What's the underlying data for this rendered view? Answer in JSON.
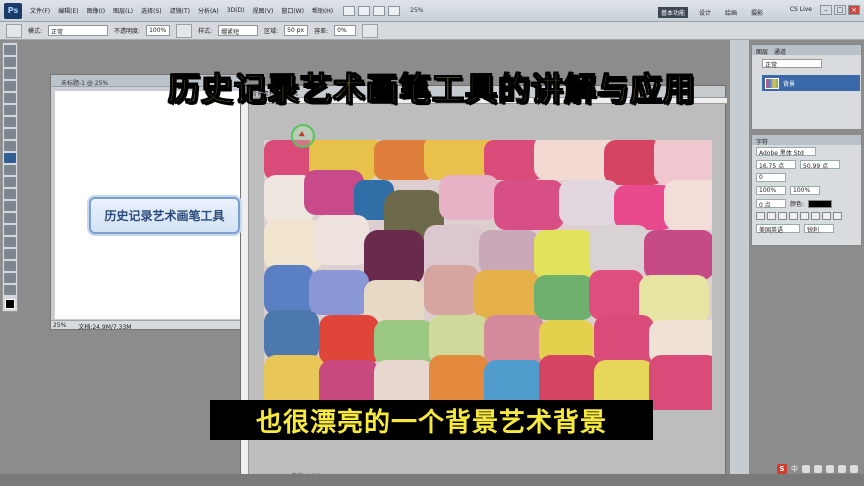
{
  "app": {
    "logo": "Ps",
    "menus": [
      "文件(F)",
      "编辑(E)",
      "图像(I)",
      "图层(L)",
      "选择(S)",
      "滤镜(T)",
      "分析(A)",
      "3D(D)",
      "视图(V)",
      "窗口(W)",
      "帮助(H)"
    ],
    "zoom": "25%",
    "workspaces": [
      "基本功能",
      "设计",
      "绘画",
      "摄影"
    ],
    "active_workspace": "基本功能",
    "cs_live": "CS Live"
  },
  "options_bar": {
    "mode_label": "模式:",
    "mode_value": "正常",
    "opacity_label": "不透明度:",
    "opacity_value": "100%",
    "style_label": "样式:",
    "style_value": "绷紧短",
    "area_label": "区域:",
    "area_value": "50 px",
    "tolerance_label": "容差:",
    "tolerance_value": "0%"
  },
  "left_document": {
    "tab": "未标题-1 @ 25%",
    "zoom": "25%",
    "status": "文档:24.9M/7.33M",
    "mind_node": "历史记录艺术画笔工具"
  },
  "right_document": {
    "tab": "背景素材 @ 25%",
    "status": "文档:4.9M"
  },
  "layers_panel": {
    "tabs": [
      "图层",
      "通道"
    ],
    "blend": "正常",
    "layer_name": "背景"
  },
  "character_panel": {
    "tabs": [
      "字符"
    ],
    "font": "Adobe 黑体 Std",
    "size": "16.75 点",
    "leading": "50.99 点",
    "tracking": "0",
    "vscale": "100%",
    "hscale": "100%",
    "baseline": "0 点",
    "color_label": "颜色:",
    "language": "美国英语",
    "aa": "锐利"
  },
  "overlay": {
    "title": "历史记录艺术画笔工具的讲解与应用",
    "subtitle": "也很漂亮的一个背景艺术背景"
  },
  "tray": {
    "s_logo": "S",
    "ime": "中",
    "colors": {
      "title": "#ffe94a",
      "subtitle": "#f7e93d",
      "accent": "#3969a9"
    }
  }
}
